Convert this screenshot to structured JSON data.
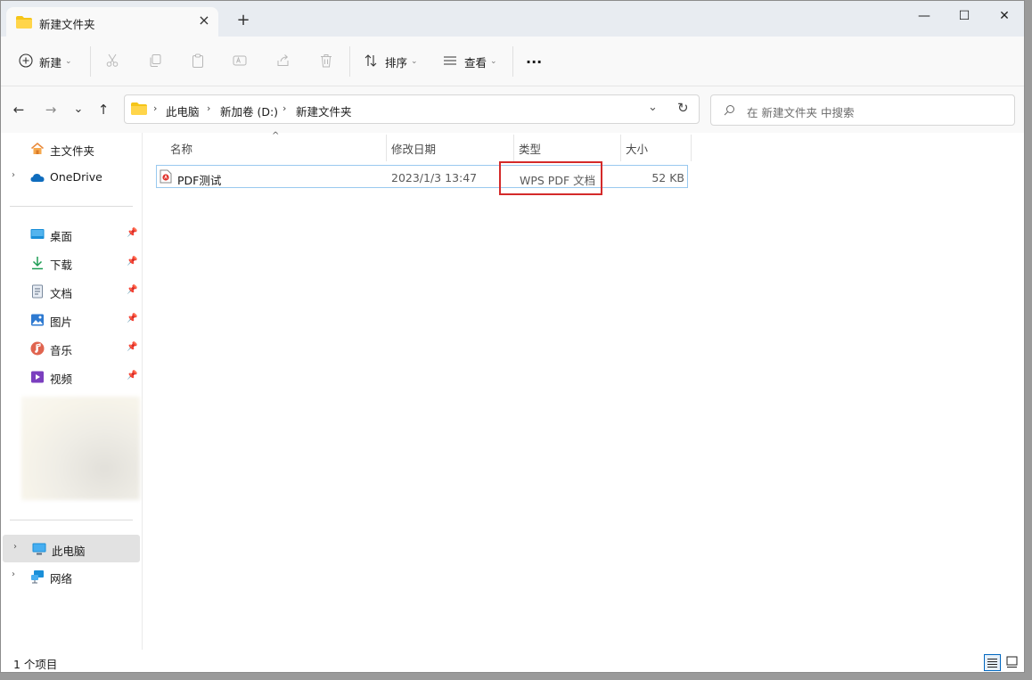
{
  "tab": {
    "title": "新建文件夹",
    "close": "×",
    "new_tab": "+"
  },
  "window_controls": {
    "minimize": "—",
    "maximize": "☐",
    "close": "✕"
  },
  "toolbar": {
    "new_label": "新建",
    "sort_label": "排序",
    "view_label": "查看",
    "more": "···",
    "disabled_actions": [
      "cut",
      "copy",
      "paste",
      "rename",
      "share",
      "delete"
    ]
  },
  "nav": {
    "back": "←",
    "forward": "→",
    "recent": "⌄",
    "up": "↑",
    "refresh": "↻",
    "addr_dropdown": "⌄"
  },
  "breadcrumb": [
    "此电脑",
    "新加卷 (D:)",
    "新建文件夹"
  ],
  "search": {
    "placeholder": "在 新建文件夹 中搜索"
  },
  "sidebar": {
    "home": "主文件夹",
    "onedrive": "OneDrive",
    "quick_access": [
      {
        "label": "桌面",
        "icon": "desktop-icon"
      },
      {
        "label": "下载",
        "icon": "download-icon"
      },
      {
        "label": "文档",
        "icon": "document-icon"
      },
      {
        "label": "图片",
        "icon": "picture-icon"
      },
      {
        "label": "音乐",
        "icon": "music-icon"
      },
      {
        "label": "视频",
        "icon": "video-icon"
      }
    ],
    "this_pc": "此电脑",
    "network": "网络"
  },
  "columns": {
    "name": "名称",
    "modified": "修改日期",
    "type": "类型",
    "size": "大小"
  },
  "files": [
    {
      "name": "PDF测试",
      "modified": "2023/1/3 13:47",
      "type": "WPS PDF 文档",
      "size": "52 KB"
    }
  ],
  "status": {
    "count": "1 个项目"
  },
  "colors": {
    "accent": "#0067c0",
    "highlight_box": "#d42a2a",
    "row_border": "#99c9ef",
    "folder": "#f5c518"
  }
}
